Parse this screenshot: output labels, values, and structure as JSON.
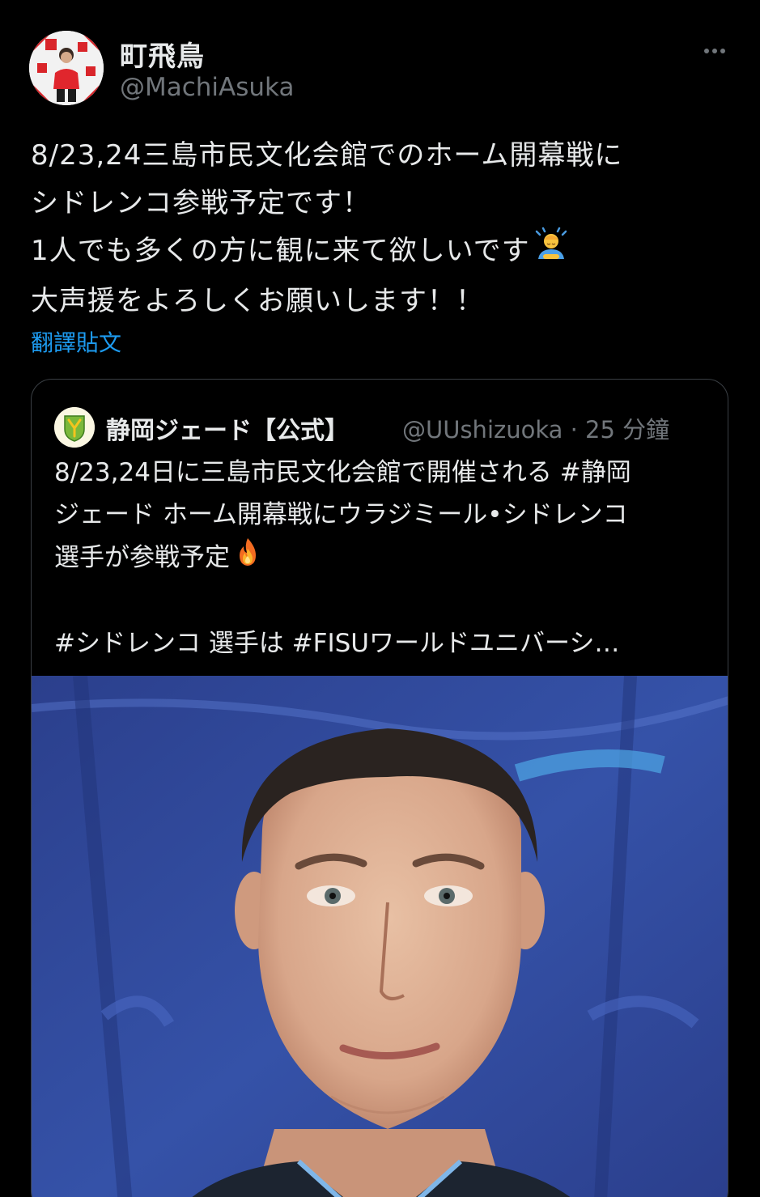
{
  "tweet": {
    "author": {
      "display_name": "町飛鳥",
      "handle": "@MachiAsuka",
      "avatar_icon": "profile-photo"
    },
    "more_icon": "more-horizontal-icon",
    "text_lines": [
      "8/23,24三島市民文化会館でのホーム開幕戦に",
      "シドレンコ参戦予定です！",
      "1人でも多くの方に観に来て欲しいです",
      "大声援をよろしくお願いします！！"
    ],
    "emoji_after_line3": "man-bowing-emoji",
    "translate_label": "翻譯貼文"
  },
  "quote": {
    "author": {
      "display_name": "静岡ジェード【公式】",
      "handle_and_time": "@UUshizuoka · 25 分鐘",
      "avatar_icon": "club-logo"
    },
    "text_lines": [
      "8/23,24日に三島市民文化会館で開催される #静岡",
      "ジェード ホーム開幕戦にウラジミール•シドレンコ",
      "選手が参戦予定",
      "",
      "#シドレンコ 選手は #FISUワールドユニバーシ…"
    ],
    "emoji_after_line3": "fire-emoji",
    "image": "player-portrait-photo"
  },
  "colors": {
    "background": "#000000",
    "text_primary": "#e7e9ea",
    "text_secondary": "#71767b",
    "link": "#1d9bf0",
    "card_border": "#3a3f44"
  }
}
